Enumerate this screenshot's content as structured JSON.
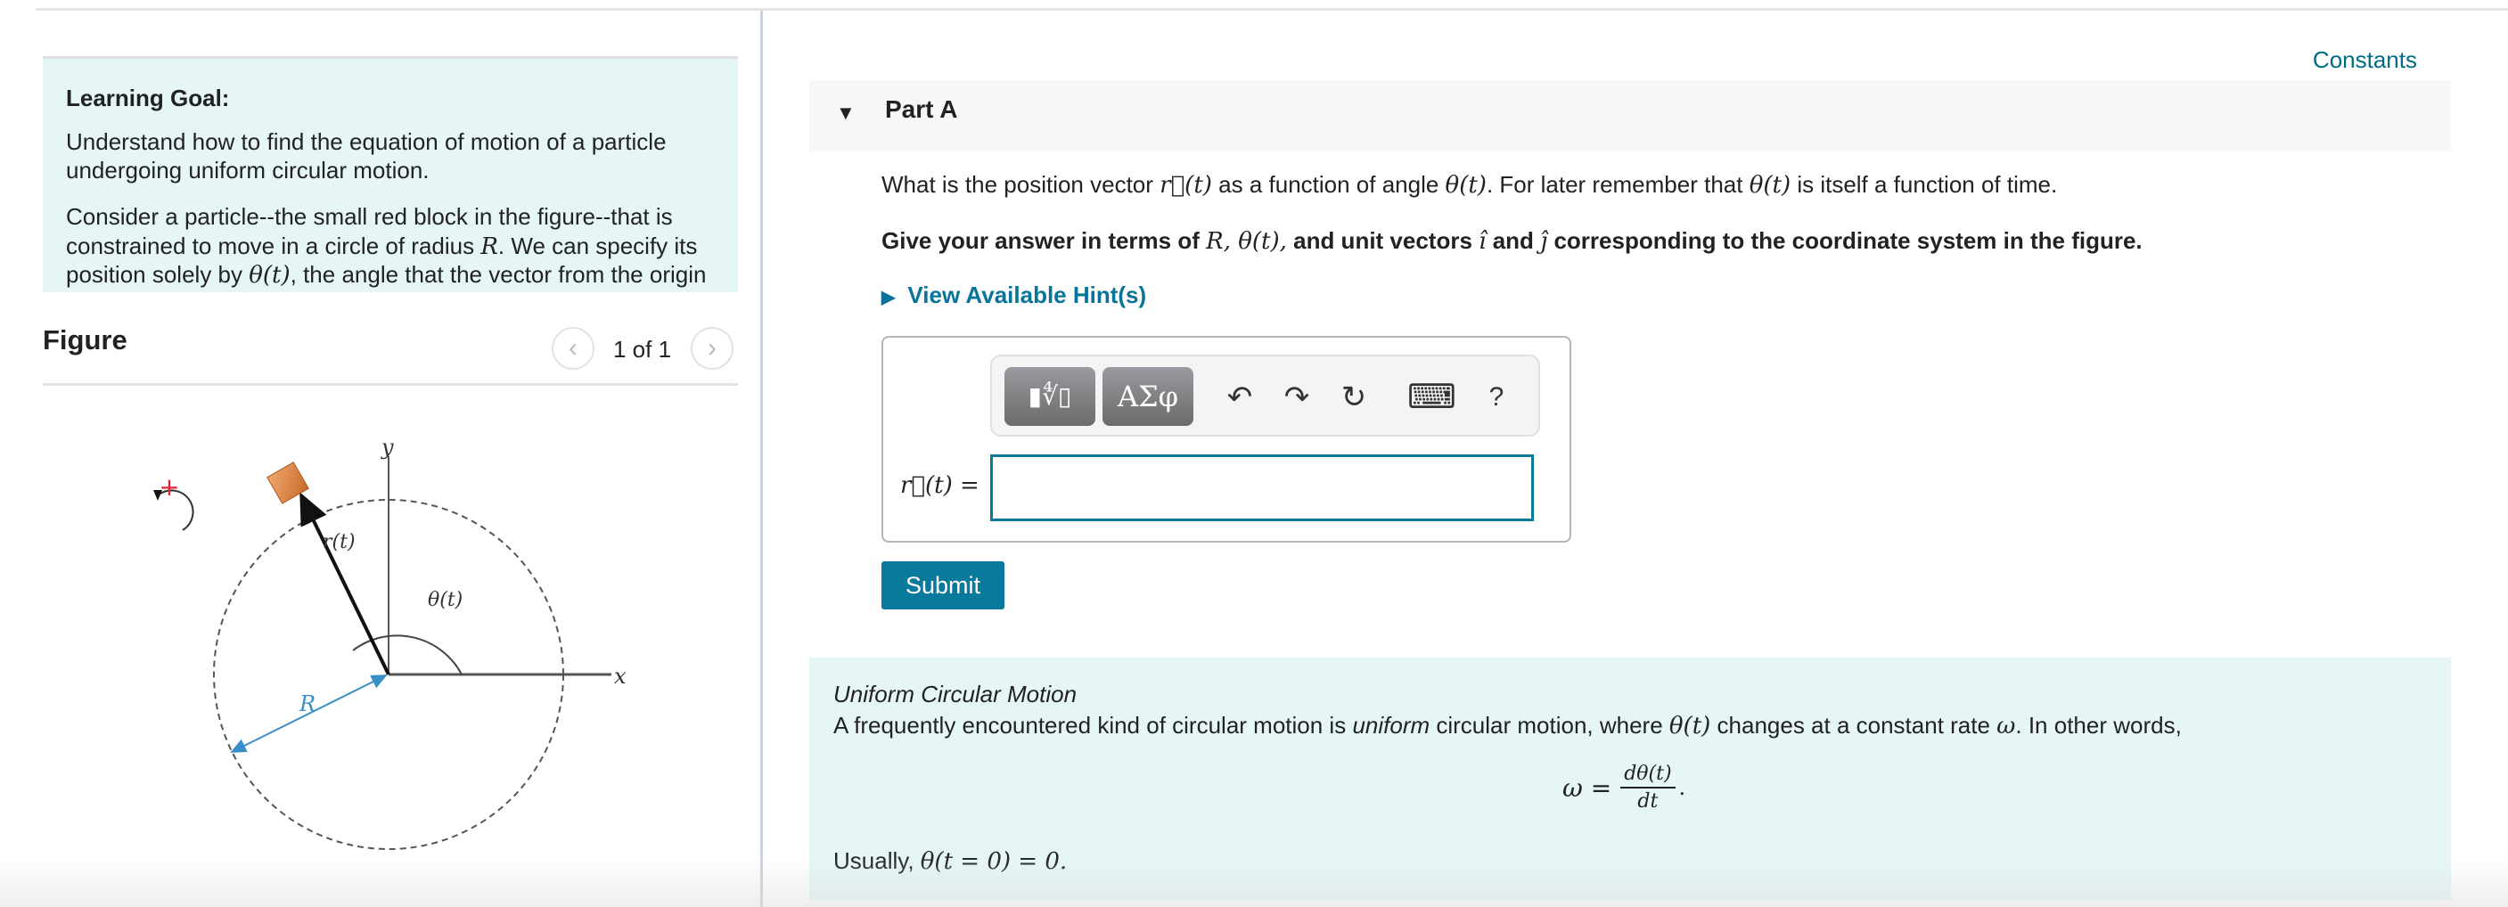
{
  "header": {
    "constants_link": "Constants"
  },
  "learning_goal": {
    "title": "Learning Goal:",
    "para1_line1": "Understand how to find the equation of motion of a particle",
    "para1_line2": "undergoing uniform circular motion.",
    "para2_line1": "Consider a particle--the small red block in the figure--that is",
    "para2_line2a": "constrained to move in a circle of radius ",
    "para2_line2_R": "R",
    "para2_line2b": ". We can specify its",
    "para2_line3a": "position solely by ",
    "para2_line3_theta": "θ(t)",
    "para2_line3b": ", the angle that the vector from the origin"
  },
  "figure": {
    "title": "Figure",
    "pager": "1 of 1",
    "prev_icon": "chevron-left-icon",
    "next_icon": "chevron-right-icon",
    "labels": {
      "y": "y",
      "x": "x",
      "r": "r(t)",
      "theta": "θ(t)",
      "R": "R",
      "plus": "+"
    },
    "colors": {
      "block": "#e0894a",
      "radius": "#3a8fc8",
      "plus": "#e8203a"
    }
  },
  "part_a": {
    "title": "Part A",
    "question_a": "What is the position vector ",
    "question_r": "r⃗(t)",
    "question_b": " as a function of angle ",
    "question_theta": "θ(t)",
    "question_c": ". For later remember that ",
    "question_theta2": "θ(t)",
    "question_d": " is itself a function of time.",
    "instr_a": "Give your answer in terms of ",
    "instr_vars": "R, θ(t),",
    "instr_b": " and unit vectors ",
    "instr_i": "î",
    "instr_c": " and ",
    "instr_j": "ĵ",
    "instr_d": " corresponding to the coordinate system in the figure.",
    "hint_label": "View Available Hint(s)",
    "answer_label": "r⃗(t) =",
    "answer_value": "",
    "submit_label": "Submit",
    "toolbar": {
      "templates_label": "▮∜▯",
      "symbols_label": "ΑΣφ",
      "undo": "↶",
      "redo": "↷",
      "reset": "↻",
      "keyboard": "⌨",
      "help": "?"
    }
  },
  "info": {
    "title": "Uniform Circular Motion",
    "line_a": "A frequently encountered kind of circular motion is ",
    "line_em": "uniform",
    "line_b": " circular motion, where ",
    "line_theta": "θ(t)",
    "line_c": " changes at a constant rate ",
    "line_omega": "ω",
    "line_d": ". In other words,",
    "formula_lhs": "ω =",
    "formula_num": "dθ(t)",
    "formula_den": "dt",
    "formula_end": ".",
    "usually_a": "Usually, ",
    "usually_math": "θ(t = 0) = 0."
  }
}
